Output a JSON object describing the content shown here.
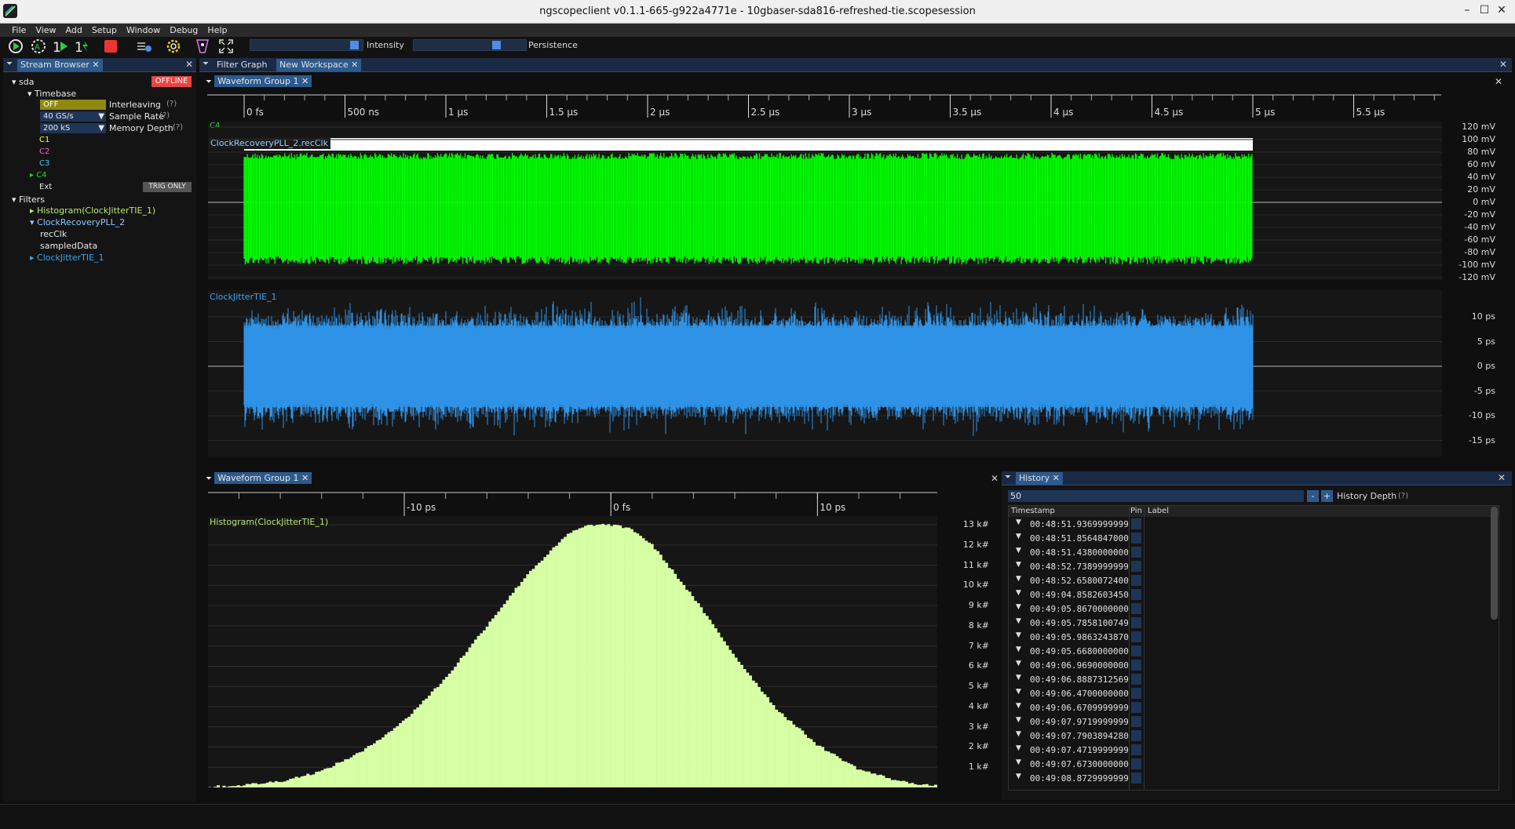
{
  "window": {
    "title": "ngscopeclient v0.1.1-665-g922a4771e  - 10gbaser-sda816-refreshed-tie.scopesession",
    "min": "–",
    "max": "☐",
    "close": "✕"
  },
  "menu": [
    "File",
    "View",
    "Add",
    "Setup",
    "Window",
    "Debug",
    "Help"
  ],
  "toolbar": {
    "intensity_label": "Intensity",
    "persistence_label": "Persistence",
    "intensity_level": 0.97,
    "persistence_level": 0.76
  },
  "stream_browser": {
    "tab": "Stream Browser",
    "instrument": "sda",
    "status": "OFFLINE",
    "timebase": "Timebase",
    "interleaving_value": "OFF",
    "interleaving_label": "Interleaving",
    "sample_rate_value": "40 GS/s",
    "sample_rate_label": "Sample Rate",
    "memory_depth_value": "200 kS",
    "memory_depth_label": "Memory Depth",
    "help": "(?)",
    "channels": [
      {
        "name": "C1",
        "color": "#ffff00"
      },
      {
        "name": "C2",
        "color": "#ff5ad2"
      },
      {
        "name": "C3",
        "color": "#3cd0ff"
      },
      {
        "name": "C4",
        "color": "#2fd12f"
      }
    ],
    "ext": "Ext",
    "trig_only": "TRIG ONLY",
    "filters_label": "Filters",
    "filters": {
      "histogram": "Histogram(ClockJitterTIE_1)",
      "pll": "ClockRecoveryPLL_2",
      "recclk": "recClk",
      "sampled": "sampledData",
      "tie": "ClockJitterTIE_1"
    }
  },
  "main_tabs": {
    "filter_graph": "Filter Graph",
    "new_workspace": "New Workspace"
  },
  "waveform_group_top": {
    "tab": "Waveform Group 1",
    "time_ticks": [
      "0 fs",
      "500 ns",
      "1 µs",
      "1.5 µs",
      "2 µs",
      "2.5 µs",
      "3 µs",
      "3.5 µs",
      "4 µs",
      "4.5 µs",
      "5 µs",
      "5.5 µs"
    ],
    "c4_label": "C4",
    "recclk_label": "ClockRecoveryPLL_2.recClk",
    "voltage_ticks": [
      "120 mV",
      "100 mV",
      "80 mV",
      "60 mV",
      "40 mV",
      "20 mV",
      "0 mV",
      "-20 mV",
      "-40 mV",
      "-60 mV",
      "-80 mV",
      "-100 mV",
      "-120 mV"
    ],
    "tie_label": "ClockJitterTIE_1",
    "ps_ticks": [
      "10 ps",
      "5 ps",
      "0 ps",
      "-5 ps",
      "-10 ps",
      "-15 ps"
    ],
    "green_color": "#00ff00",
    "blue_color": "#2f93e6"
  },
  "waveform_group_bottom": {
    "tab": "Waveform Group 1",
    "x_ticks": [
      "-10 ps",
      "0 fs",
      "10 ps"
    ],
    "plot_label": "Histogram(ClockJitterTIE_1)",
    "y_ticks": [
      "13 k#",
      "12 k#",
      "11 k#",
      "10 k#",
      "9 k#",
      "8 k#",
      "7 k#",
      "6 k#",
      "5 k#",
      "4 k#",
      "3 k#",
      "2 k#",
      "1 k#"
    ],
    "fill_color": "#d6ffa4"
  },
  "chart_data": {
    "type": "bar",
    "title": "Histogram(ClockJitterTIE_1)",
    "xlabel": "",
    "ylabel": "",
    "x_unit": "ps",
    "y_unit": "k#",
    "xlim": [
      -19.5,
      15.8
    ],
    "ylim": [
      0,
      13.2
    ],
    "shape": "approximately normal, centered near -0.3 ps, std ~4.3 ps",
    "x": [
      -18,
      -16,
      -14,
      -12,
      -10,
      -8,
      -6,
      -4,
      -2,
      -1,
      0,
      1,
      2,
      4,
      6,
      8,
      10,
      12,
      14,
      15.5
    ],
    "values": [
      0.1,
      0.3,
      0.8,
      1.8,
      3.3,
      5.4,
      8.0,
      10.6,
      12.6,
      13.0,
      13.0,
      12.8,
      12.0,
      9.4,
      6.5,
      3.9,
      2.1,
      0.9,
      0.3,
      0.1
    ]
  },
  "history": {
    "tab": "History",
    "depth_value": "50",
    "minus": "-",
    "plus": "+",
    "depth_label": "History Depth",
    "help": "(?)",
    "col_timestamp": "Timestamp",
    "col_pin": "Pin",
    "col_label": "Label",
    "rows": [
      "00:48:51.9369999999",
      "00:48:51.8564847000",
      "00:48:51.4380000000",
      "00:48:52.7389999999",
      "00:48:52.6580072400",
      "00:49:04.8582603450",
      "00:49:05.8670000000",
      "00:49:05.7858100749",
      "00:49:05.9863243870",
      "00:49:05.6680000000",
      "00:49:06.9690000000",
      "00:49:06.8887312569",
      "00:49:06.4700000000",
      "00:49:06.6709999999",
      "00:49:07.9719999999",
      "00:49:07.7903894280",
      "00:49:07.4719999999",
      "00:49:07.6730000000",
      "00:49:08.8729999999"
    ]
  }
}
